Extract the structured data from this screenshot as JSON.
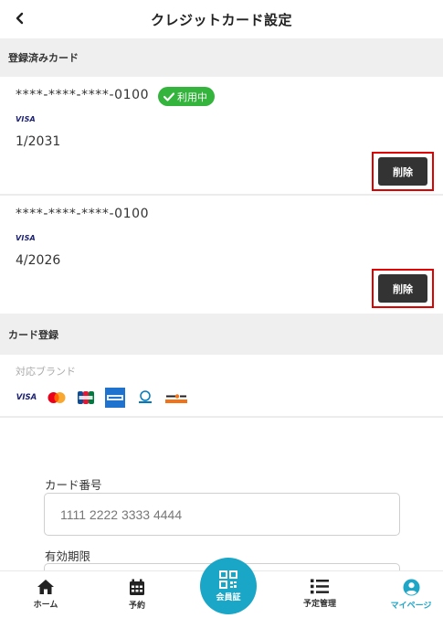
{
  "header": {
    "title": "クレジットカード設定"
  },
  "registered": {
    "section_title": "登録済みカード",
    "cards": [
      {
        "number": "****-****-****-0100",
        "brand": "VISA",
        "expiry": "1/2031",
        "badge": "利用中",
        "delete_label": "削除"
      },
      {
        "number": "****-****-****-0100",
        "brand": "VISA",
        "expiry": "4/2026",
        "delete_label": "削除"
      }
    ]
  },
  "register": {
    "section_title": "カード登録",
    "brands_label": "対応ブランド",
    "brands": [
      "VISA",
      "Mastercard",
      "JCB",
      "American Express",
      "Diners Club",
      "DISCOVER"
    ],
    "card_number_label": "カード番号",
    "card_number_placeholder": "1111 2222 3333 4444",
    "expiry_label": "有効期限"
  },
  "tabbar": {
    "items": [
      {
        "label": "ホーム",
        "icon": "home-icon"
      },
      {
        "label": "予約",
        "icon": "calendar-icon"
      },
      {
        "label": "会員証",
        "icon": "qr-code-icon"
      },
      {
        "label": "予定管理",
        "icon": "list-icon"
      },
      {
        "label": "マイページ",
        "icon": "user-circle-icon",
        "active": true
      }
    ]
  },
  "colors": {
    "accent": "#1aa6c6",
    "badge_green": "#34b33d",
    "highlight_red": "#e00000",
    "button_dark": "#333333"
  }
}
